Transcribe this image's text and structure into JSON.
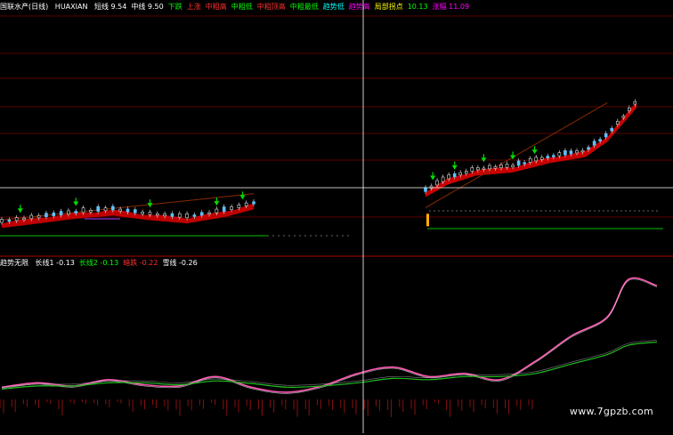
{
  "header": {
    "stock_name": "国联水产(日线)",
    "indicator": "HUAXIAN",
    "items": [
      {
        "label": "短线",
        "value": "9.54",
        "color": "#ffffff"
      },
      {
        "label": "中线",
        "value": "9.50",
        "color": "#ffffff"
      },
      {
        "label": "下跌",
        "value": "",
        "color": "#00ff00"
      },
      {
        "label": "上涨",
        "value": "",
        "color": "#ff3030"
      },
      {
        "label": "中粗高",
        "value": "",
        "color": "#ff3030"
      },
      {
        "label": "中粗低",
        "value": "",
        "color": "#00ff00"
      },
      {
        "label": "中粗顶高",
        "value": "",
        "color": "#ff3030"
      },
      {
        "label": "中粗最低",
        "value": "",
        "color": "#00ff00"
      },
      {
        "label": "趋势低",
        "value": "",
        "color": "#00ffff"
      },
      {
        "label": "趋势高",
        "value": "",
        "color": "#ff00ff"
      },
      {
        "label": "局部拐点",
        "value": "",
        "color": "#ffff00"
      },
      {
        "label": "",
        "value": "10.13",
        "color": "#00ff00"
      },
      {
        "label": "涨幅",
        "value": "11.09",
        "color": "#ff00ff"
      }
    ]
  },
  "sub_header": {
    "title": "趋势无限",
    "items": [
      {
        "label": "长线1",
        "value": "-0.13",
        "color": "#ffffff"
      },
      {
        "label": "长线2",
        "value": "-0.13",
        "color": "#00ff00"
      },
      {
        "label": "暗跌",
        "value": "-0.22",
        "color": "#ff3030"
      },
      {
        "label": "雪线",
        "value": "-0.26",
        "color": "#ffffff"
      }
    ]
  },
  "watermark": "www.7gpzb.com",
  "colors": {
    "background": "#000000",
    "grid_red": "#7a0000",
    "cross": "#ffffff",
    "band_red": "#e00000",
    "candle_up": "#e8e8e8",
    "pink_line": "#ff5ab4",
    "green_line": "#20c020",
    "histogram": "#8a1010",
    "support_green": "#00c000",
    "arrow_green": "#00e000"
  },
  "chart_data": [
    {
      "type": "line",
      "panel": "price",
      "x_index": [
        0,
        10,
        20,
        30,
        40,
        50,
        60,
        68,
        80,
        90,
        100,
        110,
        120,
        126,
        132,
        140,
        150,
        160,
        170,
        176,
        184
      ],
      "series": [
        {
          "name": "短线",
          "values": [
            7.2,
            7.35,
            7.5,
            7.6,
            7.45,
            7.35,
            7.55,
            7.8,
            7.7,
            7.6,
            7.5,
            7.3,
            7.45,
            8.2,
            8.6,
            8.9,
            9.0,
            9.3,
            9.5,
            10.0,
            11.09
          ]
        }
      ],
      "markers": {
        "green_arrows_count": 10
      }
    },
    {
      "type": "line",
      "panel": "indicator",
      "x_index": [
        0,
        10,
        20,
        30,
        40,
        50,
        60,
        70,
        80,
        90,
        100,
        110,
        120,
        130,
        140,
        150,
        160,
        170,
        176,
        184
      ],
      "series": [
        {
          "name": "长线1",
          "values": [
            -0.12,
            -0.05,
            -0.1,
            0.0,
            -0.08,
            -0.1,
            0.05,
            -0.12,
            -0.2,
            -0.1,
            0.1,
            0.2,
            0.05,
            0.1,
            0.0,
            0.3,
            0.7,
            1.0,
            1.6,
            1.5
          ]
        },
        {
          "name": "长线2",
          "values": [
            -0.15,
            -0.1,
            -0.1,
            -0.05,
            -0.05,
            -0.08,
            -0.02,
            -0.06,
            -0.12,
            -0.1,
            -0.05,
            0.02,
            0.0,
            0.05,
            0.05,
            0.1,
            0.25,
            0.4,
            0.55,
            0.6
          ]
        }
      ],
      "histogram_count": 46
    }
  ]
}
